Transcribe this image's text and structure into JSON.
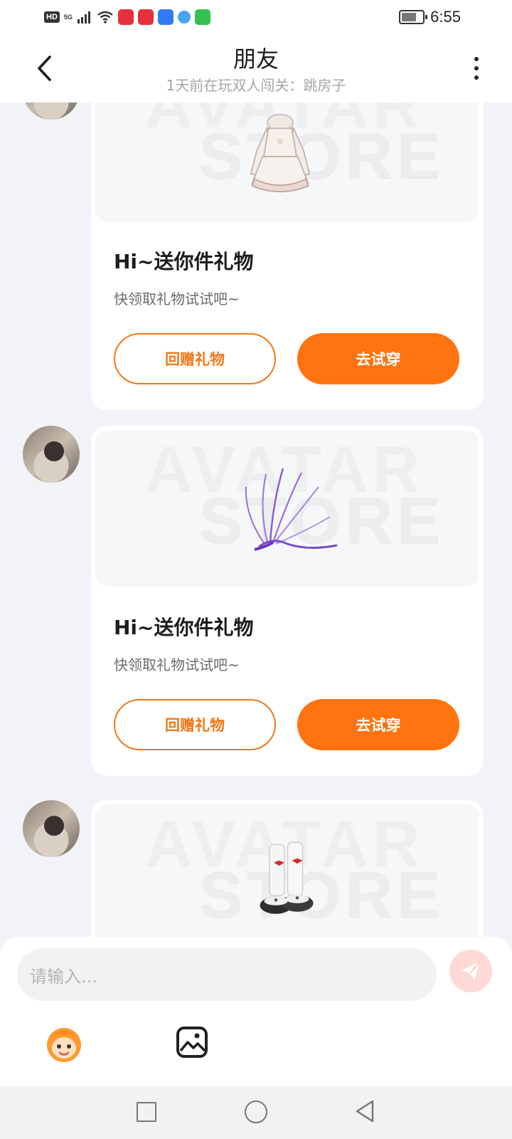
{
  "status_bar": {
    "indicators": [
      "HD",
      "5G"
    ],
    "time": "6:55",
    "battery_level": 0.7
  },
  "header": {
    "title": "朋友",
    "subtitle": "1天前在玩双人闯关：跳房子"
  },
  "messages": [
    {
      "gift_item": "white-lace-dress",
      "watermark_line1": "AVATAR",
      "watermark_line2": "STORE",
      "title": "Hi~送你件礼物",
      "desc": "快领取礼物试试吧~",
      "return_gift_label": "回赠礼物",
      "try_on_label": "去试穿"
    },
    {
      "gift_item": "purple-feather-fan",
      "watermark_line1": "AVATAR",
      "watermark_line2": "STORE",
      "title": "Hi~送你件礼物",
      "desc": "快领取礼物试试吧~",
      "return_gift_label": "回赠礼物",
      "try_on_label": "去试穿"
    },
    {
      "gift_item": "leg-warmers-shoes",
      "watermark_line1": "AVATAR",
      "watermark_line2": "STORE"
    }
  ],
  "input": {
    "placeholder": "请输入..."
  },
  "colors": {
    "accent": "#ff7410",
    "accent_outline": "#f07818",
    "background": "#f1f3f6",
    "send_button": "#ffd9d6"
  },
  "icons": [
    "back-arrow-icon",
    "more-vertical-icon",
    "send-icon",
    "emoji-icon",
    "image-icon",
    "nav-recents-icon",
    "nav-home-icon",
    "nav-back-icon"
  ]
}
